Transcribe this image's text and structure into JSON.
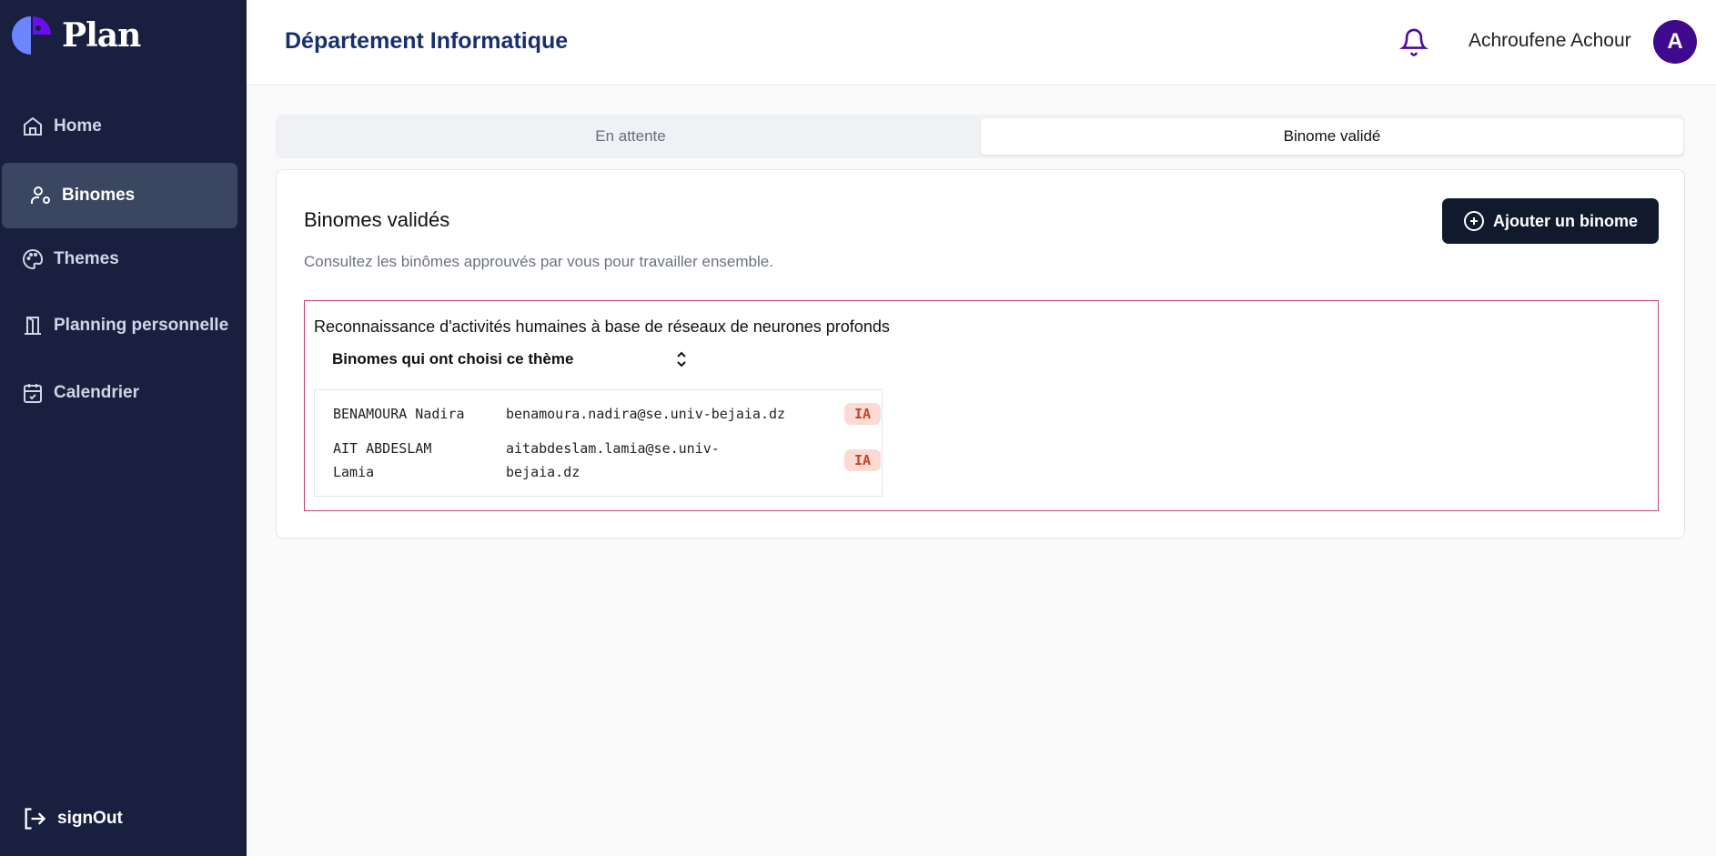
{
  "app": {
    "name": "Plan"
  },
  "sidebar": {
    "items": [
      {
        "label": "Home",
        "icon": "home-icon"
      },
      {
        "label": "Binomes",
        "icon": "user-cog-icon",
        "active": true
      },
      {
        "label": "Themes",
        "icon": "palette-icon"
      },
      {
        "label": "Planning personnelle",
        "icon": "door-icon"
      },
      {
        "label": "Calendrier",
        "icon": "calendar-check-icon"
      }
    ],
    "signout": "signOut"
  },
  "header": {
    "title": "Département Informatique",
    "user_name": "Achroufene Achour",
    "avatar_initial": "A"
  },
  "tabs": [
    {
      "label": "En attente"
    },
    {
      "label": "Binome validé",
      "active": true
    }
  ],
  "card": {
    "title": "Binomes validés",
    "subtitle": "Consultez les binômes approuvés par vous pour travailler ensemble.",
    "add_button": "Ajouter un binome"
  },
  "theme": {
    "title": "Reconnaissance d'activités humaines à base de réseaux de neurones profonds",
    "select_label": "Binomes qui ont choisi ce thème",
    "rows": [
      {
        "name": "BENAMOURA Nadira",
        "email": "benamoura.nadira@se.univ-bejaia.dz",
        "badge": "IA"
      },
      {
        "name": "AIT ABDESLAM Lamia",
        "email": "aitabdeslam.lamia@se.univ-bejaia.dz",
        "badge": "IA"
      }
    ]
  },
  "colors": {
    "sidebar": "#19203f",
    "accent": "#3f0a8d",
    "border_theme": "#c2437b"
  }
}
